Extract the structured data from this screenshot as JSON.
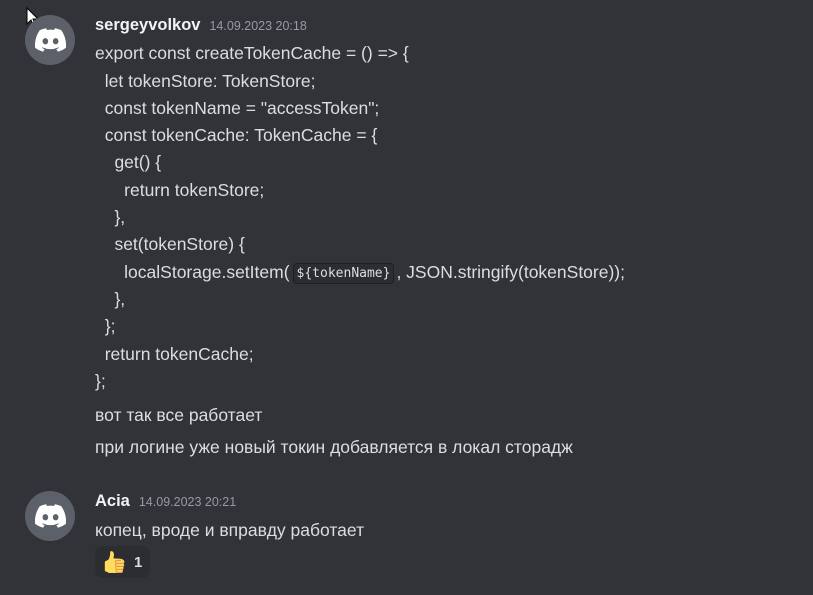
{
  "messages": [
    {
      "username": "sergeyvolkov",
      "timestamp": "14.09.2023 20:18",
      "code_lines": [
        "export const createTokenCache = () => {",
        "  let tokenStore: TokenStore;",
        "  const tokenName = \"accessToken\";",
        "  const tokenCache: TokenCache = {",
        "    get() {",
        "      return tokenStore;",
        "    },",
        "    set(tokenStore) {",
        "    },",
        "  };",
        "  return tokenCache;",
        "};"
      ],
      "setitem_prefix": "      localStorage.setItem(",
      "setitem_code": "${tokenName}",
      "setitem_suffix": ", JSON.stringify(tokenStore));",
      "text1": "вот так все работает",
      "text2": "при логине уже новый токин добавляется в локал сторадж"
    },
    {
      "username": "Acia",
      "timestamp": "14.09.2023 20:21",
      "text1": "копец, вроде и вправду работает",
      "reaction_emoji": "thumbs-up-icon",
      "reaction_count": "1"
    }
  ],
  "colors": {
    "background": "#313338",
    "username": "#f2f3f5",
    "timestamp": "#949ba4",
    "text": "#dbdee1",
    "avatar": "#5c6068"
  }
}
